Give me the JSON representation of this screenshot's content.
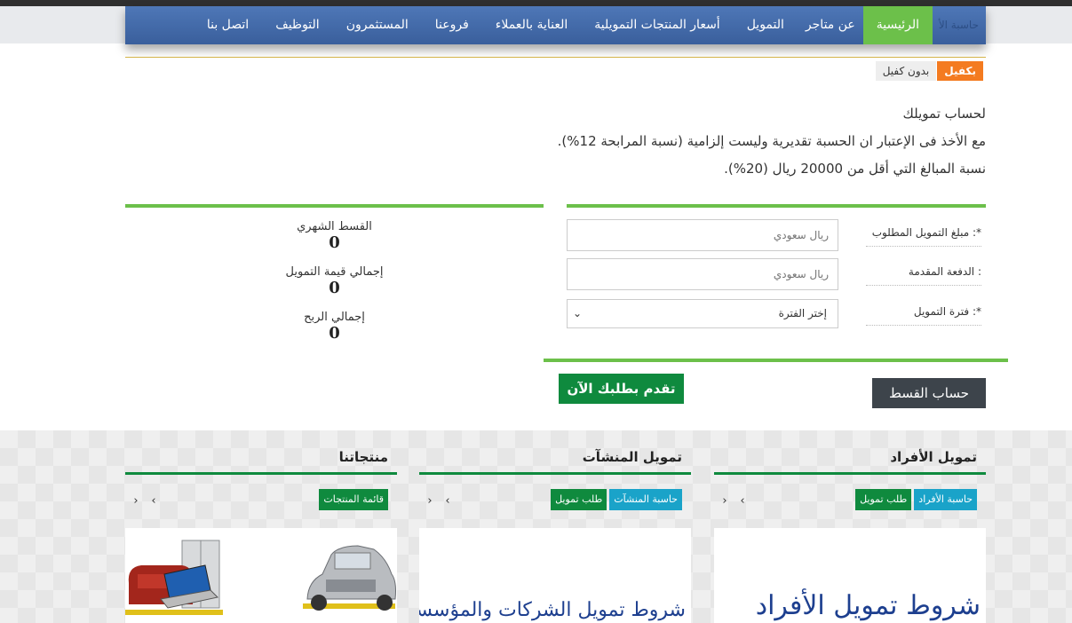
{
  "nav": {
    "items": [
      {
        "label": "حاسبة الأ",
        "state": "ghost"
      },
      {
        "label": "الرئيسية",
        "state": "active"
      },
      {
        "label": "عن متاجر",
        "state": "normal"
      },
      {
        "label": "التمويل",
        "state": "normal"
      },
      {
        "label": "أسعار المنتجات التمويلية",
        "state": "normal"
      },
      {
        "label": "العناية بالعملاء",
        "state": "normal"
      },
      {
        "label": "فروعنا",
        "state": "normal"
      },
      {
        "label": "المستثمرون",
        "state": "normal"
      },
      {
        "label": "التوظيف",
        "state": "normal"
      },
      {
        "label": "اتصل بنا",
        "state": "normal"
      }
    ]
  },
  "tabs": {
    "with_guarantor": "بكفيل",
    "without_guarantor": "بدون كفيل"
  },
  "intro": {
    "line1": "لحساب تمويلك",
    "line2": "مع الأخذ فى الإعتبار ان الحسبة تقديرية وليست إلزامية (نسبة المرابحة 12%).",
    "line3": "نسبة المبالغ التي أقل من 20000 ريال (20%)."
  },
  "form": {
    "amount_label": "مبلغ التمويل المطلوب :*",
    "amount_placeholder": "ريال سعودي",
    "down_label": "الدفعة المقدمة :",
    "down_placeholder": "ريال سعودي",
    "period_label": "فترة التمويل :*",
    "period_selected": "إختر الفترة"
  },
  "results": {
    "monthly_label": "القسط الشهري",
    "monthly_value": "0",
    "total_label": "إجمالي قيمة التمويل",
    "total_value": "0",
    "profit_label": "إجمالي الربح",
    "profit_value": "0"
  },
  "buttons": {
    "apply": "تقدم بطلبك الآن",
    "calculate": "حساب القسط"
  },
  "sections": {
    "individuals": {
      "title": "تمويل الأفراد",
      "btn_calc": "حاسبة الأفراد",
      "btn_request": "طلب تمويل",
      "panel_text": "شروط تمويل الأفراد"
    },
    "companies": {
      "title": "تمويل المنشآت",
      "btn_calc": "حاسبة المنشآت",
      "btn_request": "طلب تمويل",
      "panel_text": "شروط تمويل الشركات والمؤسسات"
    },
    "products": {
      "title": "منتجاتنا",
      "btn_list": "قائمة المنتجات"
    }
  },
  "arrows": {
    "prev": "‹",
    "next": "›"
  },
  "colors": {
    "nav_blue": "#4e77b7",
    "active_green": "#6cc04a",
    "accent_orange": "#f47b20",
    "dark_green": "#0f8a3e",
    "teal": "#1aa3c9",
    "dark_gray": "#3d444b"
  }
}
